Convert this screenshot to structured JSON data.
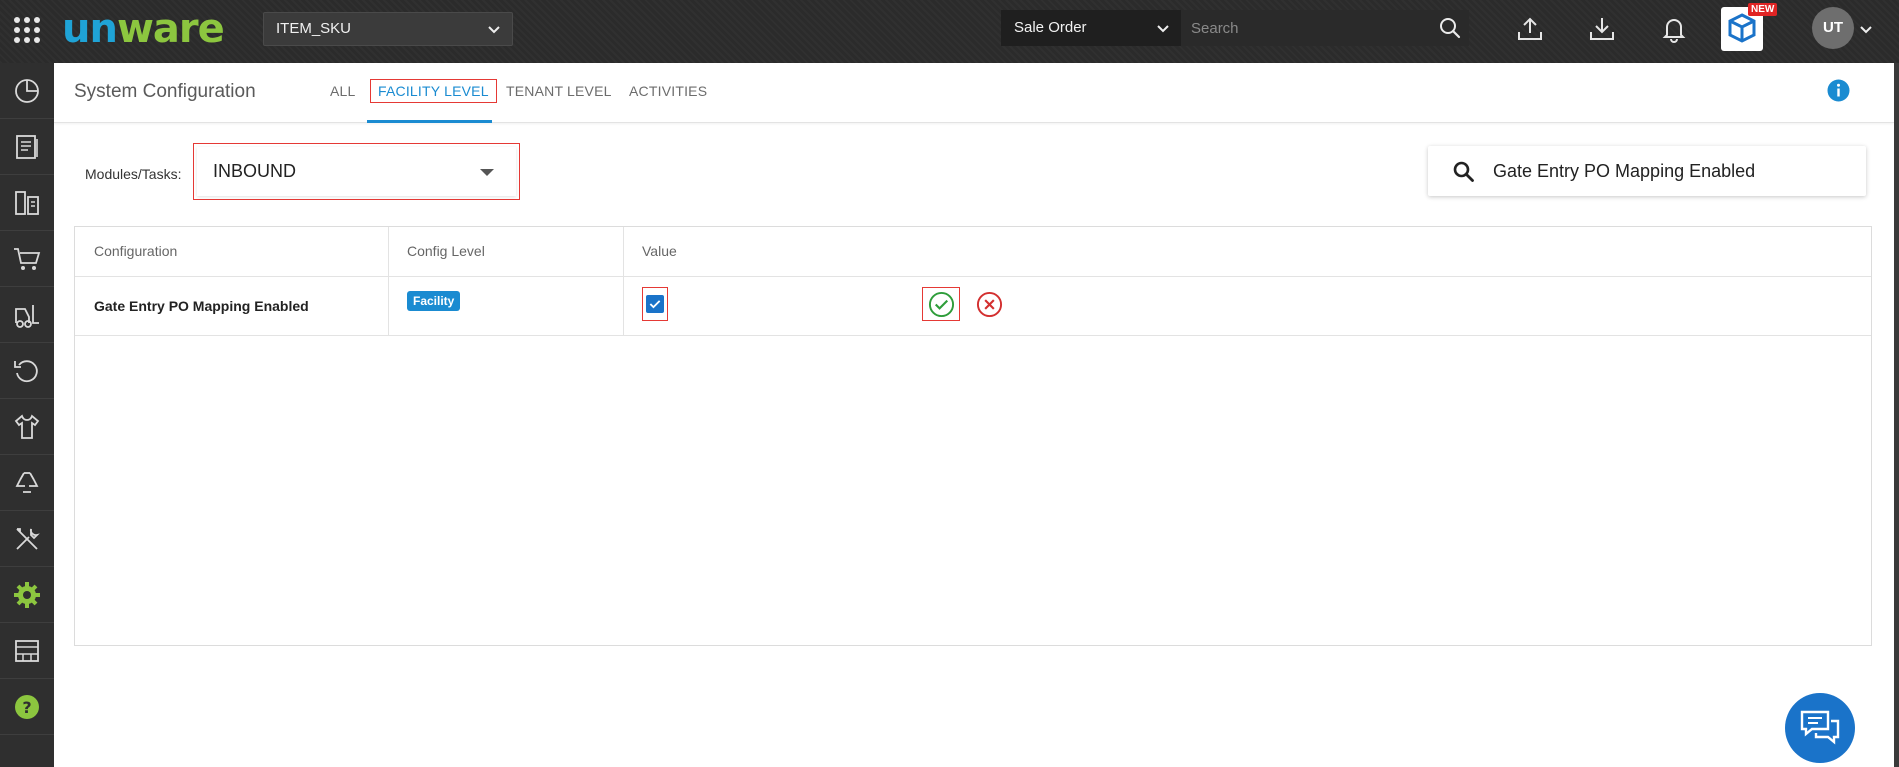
{
  "topbar": {
    "logo": {
      "part1": "un",
      "part2": "ware"
    },
    "sku_select": "ITEM_SKU",
    "order_type_select": "Sale Order",
    "search_placeholder": "Search",
    "new_badge": "NEW",
    "avatar_initials": "UT"
  },
  "sidebar": {
    "items": [
      {
        "icon": "dashboard-icon"
      },
      {
        "icon": "reports-icon"
      },
      {
        "icon": "inventory-icon"
      },
      {
        "icon": "cart-icon"
      },
      {
        "icon": "forklift-icon"
      },
      {
        "icon": "returns-icon"
      },
      {
        "icon": "apparel-icon"
      },
      {
        "icon": "recycle-icon"
      },
      {
        "icon": "tools-icon"
      },
      {
        "icon": "settings-icon",
        "active_color": "#8cc63f"
      },
      {
        "icon": "warehouse-icon"
      },
      {
        "icon": "help-icon",
        "active_color": "#8cc63f"
      }
    ]
  },
  "header": {
    "title": "System Configuration",
    "tabs": [
      {
        "label": "ALL",
        "active": false
      },
      {
        "label": "FACILITY LEVEL",
        "active": true
      },
      {
        "label": "TENANT LEVEL",
        "active": false
      },
      {
        "label": "ACTIVITIES",
        "active": false
      }
    ]
  },
  "filters": {
    "modules_label": "Modules/Tasks:",
    "modules_value": "INBOUND",
    "config_search_value": "Gate Entry PO Mapping Enabled"
  },
  "table": {
    "columns": [
      "Configuration",
      "Config Level",
      "Value"
    ],
    "rows": [
      {
        "configuration": "Gate Entry PO Mapping Enabled",
        "config_level": "Facility",
        "value_checked": true
      }
    ]
  },
  "colors": {
    "accent": "#1a8bd1",
    "brand_green": "#8cc63f",
    "highlight_red": "#e53935",
    "ok_green": "#2e9d3a",
    "cancel_red": "#d32f2f"
  }
}
